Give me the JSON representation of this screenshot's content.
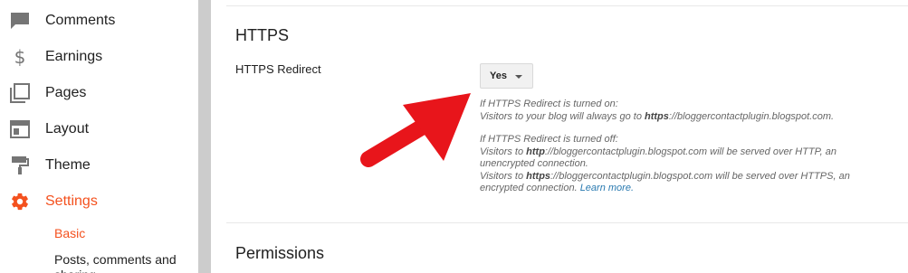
{
  "sidebar": {
    "items": [
      {
        "label": "Comments",
        "icon": "comment-icon"
      },
      {
        "label": "Earnings",
        "icon": "dollar-icon"
      },
      {
        "label": "Pages",
        "icon": "pages-icon"
      },
      {
        "label": "Layout",
        "icon": "layout-icon"
      },
      {
        "label": "Theme",
        "icon": "paint-roller-icon"
      },
      {
        "label": "Settings",
        "icon": "gear-icon",
        "active": true
      }
    ],
    "sub_items": [
      {
        "label": "Basic",
        "active": true
      },
      {
        "label": "Posts, comments and sharing"
      }
    ]
  },
  "main": {
    "https": {
      "title": "HTTPS",
      "redirect_label": "HTTPS Redirect",
      "redirect_value": "Yes",
      "help_on": {
        "line1": "If HTTPS Redirect is turned on:",
        "line2_pre": "Visitors to your blog will always go to ",
        "line2_bold": "https",
        "line2_post": "://bloggercontactplugin.blogspot.com."
      },
      "help_off": {
        "line1": "If HTTPS Redirect is turned off:",
        "line2_pre": "Visitors to ",
        "line2_bold": "http",
        "line2_post": "://bloggercontactplugin.blogspot.com will be served over HTTP, an unencrypted connection.",
        "line3_pre": "Visitors to ",
        "line3_bold": "https",
        "line3_post": "://bloggercontactplugin.blogspot.com will be served over HTTPS, an encrypted connection. ",
        "learn_more": "Learn more."
      }
    },
    "permissions": {
      "title": "Permissions"
    }
  },
  "colors": {
    "accent": "#f4511e",
    "arrow": "#e8151b",
    "link": "#2a7ab0"
  }
}
